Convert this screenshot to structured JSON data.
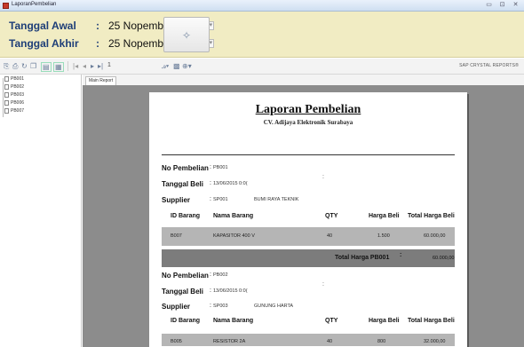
{
  "window": {
    "title": "LaporanPembelian",
    "buttons": [
      "▭",
      "⊡",
      "✕"
    ]
  },
  "parameters": {
    "tanggal_awal": {
      "label": "Tanggal Awal",
      "colon": ":",
      "value": "25 Nopember 2015"
    },
    "tanggal_akhir": {
      "label": "Tanggal Akhir",
      "colon": ":",
      "value": "25 Nopember 2015"
    },
    "dropdown_glyph": "⊞▾",
    "run_glyph": "✧"
  },
  "toolbar": {
    "page_number": "1",
    "brand": "SAP CRYSTAL REPORTS®",
    "icons": [
      "export-icon",
      "print-icon",
      "refresh-icon",
      "copy-icon",
      "toggle-tree-icon",
      "group-tree-icon",
      "first-page-icon",
      "prev-page-icon",
      "next-page-icon",
      "last-page-icon",
      "search-text-icon",
      "zoom-icon"
    ]
  },
  "tree": {
    "items": [
      "PB001",
      "PB002",
      "PB003",
      "PB006",
      "PB007"
    ]
  },
  "tabs": {
    "main": "Main Report"
  },
  "report": {
    "title": "Laporan Pembelian",
    "company": "CV. Adijaya Elektronik Surabaya",
    "labels": {
      "no_pembelian": "No Pembelian",
      "tanggal_beli": "Tanggal Beli",
      "supplier": "Supplier",
      "colon": ":"
    },
    "columns": {
      "id_barang": "ID Barang",
      "nama_barang": "Nama Barang",
      "qty": "QTY",
      "harga_beli": "Harga Beli",
      "total_harga_beli": "Total Harga Beli"
    },
    "groups": [
      {
        "no_pembelian": "PB001",
        "tanggal_beli": "13/06/2015 0:0(",
        "supplier_id": "SP001",
        "supplier_name": "BUMI RAYA TEKNIK",
        "rows": [
          {
            "id": "B007",
            "nama": "KAPASITOR 400 V",
            "qty": "40",
            "harga": "1.500",
            "total": "60.000,00"
          }
        ],
        "total_label": "Total Harga PB001",
        "total_colon": ":",
        "total_value": "60.000,00"
      },
      {
        "no_pembelian": "PB002",
        "tanggal_beli": "13/06/2015 0:0(",
        "supplier_id": "SP003",
        "supplier_name": "GUNUNG HARTA",
        "rows": [
          {
            "id": "B005",
            "nama": "RESISTOR 2A",
            "qty": "40",
            "harga": "800",
            "total": "32.000,00"
          }
        ]
      }
    ]
  }
}
